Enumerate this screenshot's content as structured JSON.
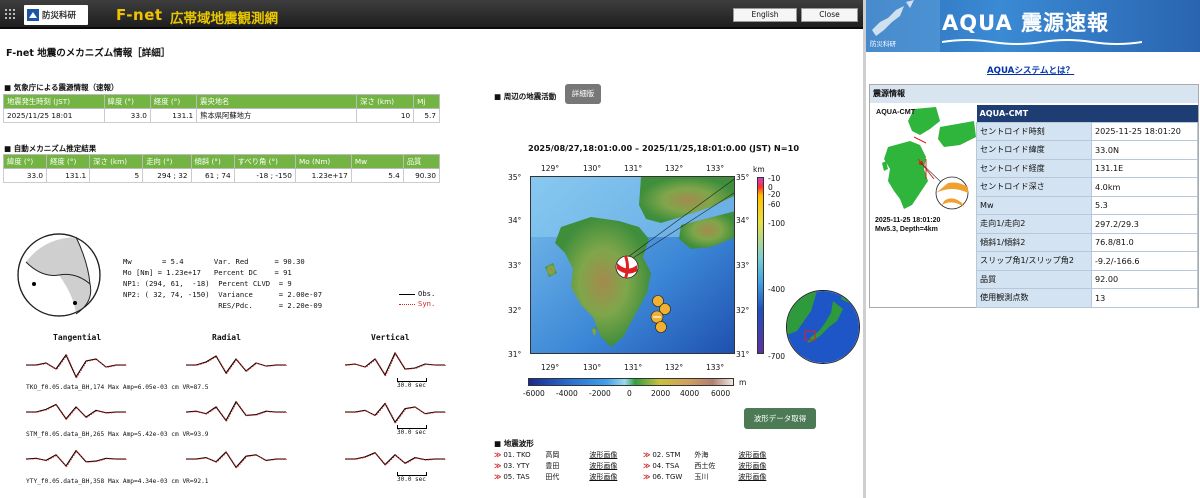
{
  "header": {
    "logo_text": "防災科研",
    "brand": "F-net",
    "network": "広帯域地震観測網",
    "english_btn": "English",
    "close_btn": "Close"
  },
  "page_title": "F-net 地震のメカニズム情報［詳細］",
  "jma": {
    "section": "■ 気象庁による震源情報（速報）",
    "headers": [
      "地震発生時刻 (JST)",
      "緯度 (°)",
      "経度 (°)",
      "震央地名",
      "深さ (km)",
      "Mj"
    ],
    "row": [
      "2025/11/25 18:01",
      "33.0",
      "131.1",
      "熊本県阿蘇地方",
      "10",
      "5.7"
    ]
  },
  "auto": {
    "section": "■ 自動メカニズム推定結果",
    "headers": [
      "緯度 (°)",
      "経度 (°)",
      "深さ (km)",
      "走向 (°)",
      "傾斜 (°)",
      "すべり角 (°)",
      "Mo (Nm)",
      "Mw",
      "品質"
    ],
    "row": [
      "33.0",
      "131.1",
      "5",
      "294 ; 32",
      "61 ; 74",
      "-18 ; -150",
      "1.23e+17",
      "5.4",
      "90.30"
    ]
  },
  "mech_text": "Mw       = 5.4       Var. Red      = 90.30\nMo [Nm] = 1.23e+17   Percent DC    = 91\nNP1: (294, 61,  -18)  Percent CLVD  = 9\nNP2: ( 32, 74, -150)  Variance      = 2.00e-07\n                      RES/Pdc.      = 2.20e-09",
  "legend": {
    "obs": "Obs.",
    "syn": "Syn."
  },
  "components": [
    "Tangential",
    "Radial",
    "Vertical"
  ],
  "stations": [
    "TKO_f0.05.data_BH,174  Max Amp=6.05e-03 cm  VR=87.5",
    "STM_f0.05.data_BH,265  Max Amp=5.42e-03 cm  VR=93.9",
    "YTY_f0.05.data_BH,358  Max Amp=4.34e-03 cm  VR=92.1"
  ],
  "scale_label": "30.0 sec",
  "nearby": {
    "section": "■ 周辺の地震活動",
    "detail_btn": "詳細版",
    "title": "2025/08/27,18:01:0.00 – 2025/11/25,18:01:0.00 (JST)  N=10",
    "lon_ticks": [
      "129°",
      "130°",
      "131°",
      "132°",
      "133°"
    ],
    "lat_ticks": [
      "35°",
      "34°",
      "33°",
      "32°",
      "31°"
    ],
    "depth_unit": "km",
    "depth_ticks": [
      "-10",
      "0",
      "-20",
      "-60",
      "-100",
      "-400",
      "-700"
    ],
    "elev_unit": "m",
    "elev_ticks": [
      "-6000",
      "-4000",
      "-2000",
      "0",
      "2000",
      "4000",
      "6000"
    ]
  },
  "waveform_btn": "波形データ取得",
  "wf": {
    "section": "■ 地震波形",
    "items": [
      {
        "id": "01. TKO",
        "name": "高岡",
        "link": "波形画像"
      },
      {
        "id": "02. STM",
        "name": "外海",
        "link": "波形画像"
      },
      {
        "id": "03. YTY",
        "name": "豊田",
        "link": "波形画像"
      },
      {
        "id": "04. TSA",
        "name": "西土佐",
        "link": "波形画像"
      },
      {
        "id": "05. TAS",
        "name": "田代",
        "link": "波形画像"
      },
      {
        "id": "06. TGW",
        "name": "玉川",
        "link": "波形画像"
      }
    ]
  },
  "aqua": {
    "logo_text": "防災科研",
    "title": "AQUA 震源速報",
    "system_link": "AQUAシステムとは？",
    "section": "震源情報",
    "thumb_title": "AQUA-CMT",
    "thumb_caption_1": "2025-11-25 18:01:20",
    "thumb_caption_2": "Mw5.3, Depth=4km",
    "table_header": "AQUA-CMT",
    "rows": [
      {
        "k": "セントロイド時刻",
        "v": "2025-11-25 18:01:20"
      },
      {
        "k": "セントロイド緯度",
        "v": "33.0N"
      },
      {
        "k": "セントロイド経度",
        "v": "131.1E"
      },
      {
        "k": "セントロイド深さ",
        "v": "4.0km"
      },
      {
        "k": "Mw",
        "v": "5.3"
      },
      {
        "k": "走向1/走向2",
        "v": "297.2/29.3"
      },
      {
        "k": "傾斜1/傾斜2",
        "v": "76.8/81.0"
      },
      {
        "k": "スリップ角1/スリップ角2",
        "v": "-9.2/-166.6"
      },
      {
        "k": "品質",
        "v": "92.00"
      },
      {
        "k": "使用観測点数",
        "v": "13"
      }
    ]
  },
  "colors": {
    "header_bg": "#2a2a2a",
    "brand_yellow": "#f0c200",
    "table_green": "#73b443",
    "obs_line": "#000000",
    "syn_line": "#e02020",
    "aqua_blue": "#3b8ad4",
    "cmt_navy": "#1d3d73"
  }
}
